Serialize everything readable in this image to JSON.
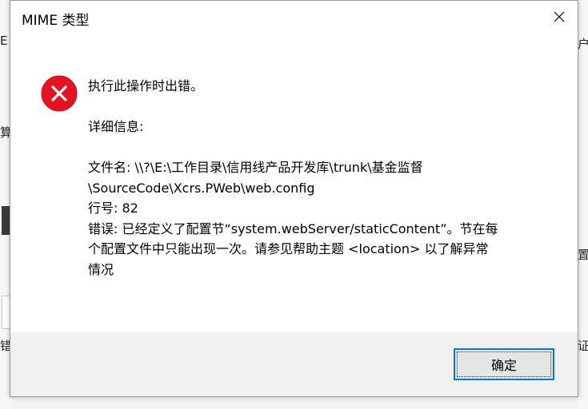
{
  "background": {
    "fragments": [
      "E",
      "户",
      "算",
      "置",
      "错",
      "证"
    ]
  },
  "dialog": {
    "title": "MIME 类型",
    "close_glyph": "✕",
    "message_lines": [
      "执行此操作时出错。",
      "",
      "详细信息:",
      "",
      "文件名: \\\\?\\E:\\工作目录\\信用线产品开发库\\trunk\\基金监督",
      "\\SourceCode\\Xcrs.PWeb\\web.config",
      "行号: 82",
      "错误: 已经定义了配置节“system.webServer/staticContent”。节在每",
      "个配置文件中只能出现一次。请参见帮助主题 <location> 以了解异常",
      "情况"
    ],
    "ok_label": "确定",
    "accent": "#0078d7",
    "error_color": "#e81123"
  }
}
